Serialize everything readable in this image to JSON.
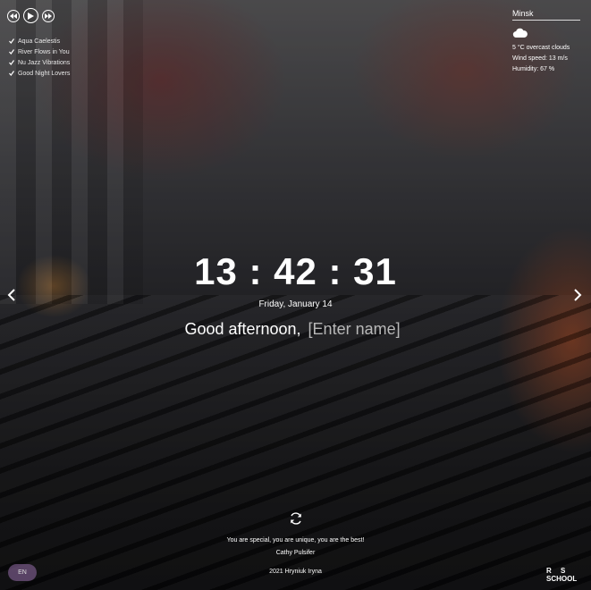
{
  "player": {
    "prev_icon": "prev-icon",
    "play_icon": "play-icon",
    "next_icon": "next-icon",
    "tracks": [
      "Aqua Caelestis",
      "River Flows in You",
      "Nu Jazz Vibrations",
      "Good Night Lovers"
    ]
  },
  "weather": {
    "city": "Minsk",
    "icon": "cloud-icon",
    "description": "5 °C  overcast clouds",
    "wind": "Wind speed: 13 m/s",
    "humidity": "Humidity: 67 %"
  },
  "clock": {
    "time": "13 : 42 : 31",
    "date": "Friday, January 14"
  },
  "greeting": {
    "text": "Good afternoon,",
    "name_placeholder": "[Enter name]"
  },
  "quote": {
    "text": "You are special, you are unique, you are the best!",
    "author": "Cathy Pulsifer"
  },
  "footer": {
    "credit": "2021 Hryniuk Iryna",
    "language": "EN",
    "logo_text": "RS SCHOOL"
  },
  "colors": {
    "language_button": "#9a6eb0"
  }
}
